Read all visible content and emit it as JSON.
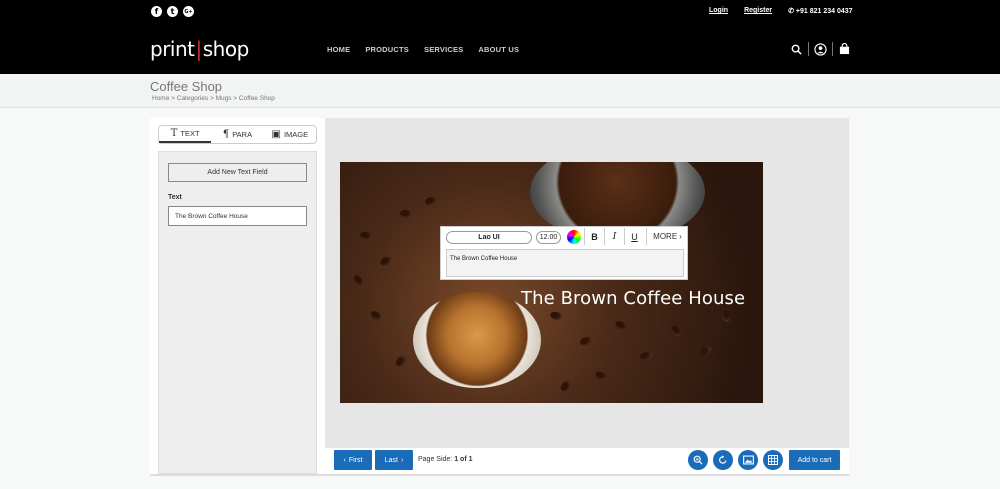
{
  "header": {
    "social": [
      {
        "name": "facebook-icon",
        "glyph": "f"
      },
      {
        "name": "twitter-icon",
        "glyph": "t"
      },
      {
        "name": "googleplus-icon",
        "glyph": "G+"
      }
    ],
    "login": "Login",
    "register": "Register",
    "phone": "+91 821 234 0437",
    "logo_left": "print",
    "logo_sep": "|",
    "logo_right": "shop",
    "nav": [
      "HOME",
      "PRODUCTS",
      "SERVICES",
      "ABOUT US"
    ]
  },
  "page": {
    "title": "Coffee Shop",
    "breadcrumb": "Home > Categories > Mugs > Coffee Shop"
  },
  "editor": {
    "tabs": [
      {
        "label": "TEXT",
        "icon": "T"
      },
      {
        "label": "PARA",
        "icon": "¶"
      },
      {
        "label": "IMAGE",
        "icon": "▣"
      }
    ],
    "add_field": "Add New Text Field",
    "text_label": "Text",
    "text_value": "The Brown Coffee House",
    "canvas_text": "The Brown Coffee House",
    "toolbar": {
      "font": "Lao UI",
      "size": "12.00",
      "bold": "B",
      "italic": "I",
      "underline": "U",
      "more": "MORE",
      "textarea": "The Brown Coffee House"
    }
  },
  "bottom": {
    "first": "First",
    "last": "Last",
    "page_side_label": "Page Side:",
    "page_side_value": "1 of 1",
    "add_to_cart": "Add to cart"
  },
  "colors": {
    "header_bg": "#000000",
    "accent_blue": "#1a6cb8",
    "logo_bar": "#c9302c"
  }
}
